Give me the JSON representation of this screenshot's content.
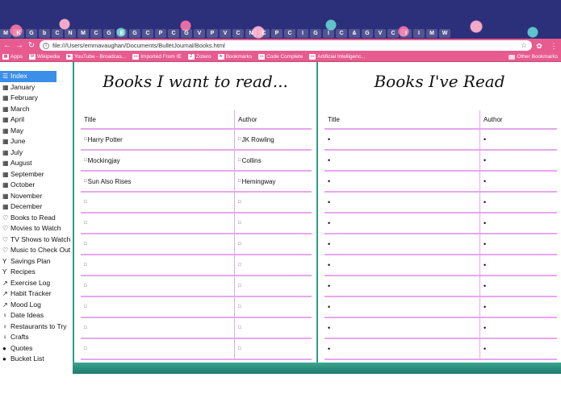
{
  "browser": {
    "tab_favicons": [
      "M",
      "K",
      "G",
      "b",
      "C",
      "N",
      "M",
      "C",
      "G",
      "E",
      "G",
      "C",
      "P",
      "C",
      "G",
      "V",
      "P",
      "V",
      "C",
      "N",
      "C",
      "P",
      "C",
      "I",
      "G",
      "I",
      "C",
      "&",
      "G",
      "V",
      "C",
      "I",
      "I",
      "M",
      "W"
    ],
    "url": "file:///Users/emmavaughan/Documents/BulletJournal/Books.html",
    "bookmarks": [
      {
        "icon": "apps-icon",
        "label": "Apps"
      },
      {
        "icon": "W",
        "label": "Wikipedia"
      },
      {
        "icon": "▶",
        "label": "YouTube - Broadcas..."
      },
      {
        "icon": "▭",
        "label": "Imported From IE"
      },
      {
        "icon": "Z",
        "label": "Zotero"
      },
      {
        "icon": "★",
        "label": "Bookmarks"
      },
      {
        "icon": "▭",
        "label": "Code Complete"
      },
      {
        "icon": "▭",
        "label": "Artificial Intelligenc..."
      }
    ],
    "other_bookmarks": "Other Bookmarks"
  },
  "sidebar": {
    "items": [
      {
        "icon": "☰",
        "label": "Index",
        "active": true
      },
      {
        "icon": "▦",
        "label": "January"
      },
      {
        "icon": "▦",
        "label": "February"
      },
      {
        "icon": "▦",
        "label": "March"
      },
      {
        "icon": "▦",
        "label": "April"
      },
      {
        "icon": "▦",
        "label": "May"
      },
      {
        "icon": "▦",
        "label": "June"
      },
      {
        "icon": "▦",
        "label": "July"
      },
      {
        "icon": "▦",
        "label": "August"
      },
      {
        "icon": "▦",
        "label": "September"
      },
      {
        "icon": "▦",
        "label": "October"
      },
      {
        "icon": "▦",
        "label": "November"
      },
      {
        "icon": "▦",
        "label": "December"
      },
      {
        "icon": "♡",
        "label": "Books to Read"
      },
      {
        "icon": "♡",
        "label": "Movies to Watch"
      },
      {
        "icon": "♡",
        "label": "TV Shows to Watch"
      },
      {
        "icon": "♡",
        "label": "Music to Check Out"
      },
      {
        "icon": "Y",
        "label": "Savings Plan"
      },
      {
        "icon": "Y",
        "label": "Recipes"
      },
      {
        "icon": "↗",
        "label": "Exercise Log"
      },
      {
        "icon": "↗",
        "label": "Habit Tracker"
      },
      {
        "icon": "↗",
        "label": "Mood Log"
      },
      {
        "icon": "♀",
        "label": "Date Ideas"
      },
      {
        "icon": "♀",
        "label": "Restaurants to Try"
      },
      {
        "icon": "♀",
        "label": "Crafts"
      },
      {
        "icon": "●",
        "label": "Quotes"
      },
      {
        "icon": "●",
        "label": "Bucket List"
      }
    ]
  },
  "want_to_read": {
    "title": "Books I want to read...",
    "col_title": "Title",
    "col_author": "Author",
    "rows": [
      {
        "title": "Harry Potter",
        "author": "JK Rowling"
      },
      {
        "title": "Mockingjay",
        "author": "Collins"
      },
      {
        "title": "Sun Also Rises",
        "author": "Hemingway"
      },
      {
        "title": "",
        "author": ""
      },
      {
        "title": "",
        "author": ""
      },
      {
        "title": "",
        "author": ""
      },
      {
        "title": "",
        "author": ""
      },
      {
        "title": "",
        "author": ""
      },
      {
        "title": "",
        "author": ""
      },
      {
        "title": "",
        "author": ""
      },
      {
        "title": "",
        "author": ""
      }
    ]
  },
  "read": {
    "title": "Books I've Read",
    "col_title": "Title",
    "col_author": "Author",
    "rows": [
      {
        "title": "",
        "author": ""
      },
      {
        "title": "",
        "author": ""
      },
      {
        "title": "",
        "author": ""
      },
      {
        "title": "",
        "author": ""
      },
      {
        "title": "",
        "author": ""
      },
      {
        "title": "",
        "author": ""
      },
      {
        "title": "",
        "author": ""
      },
      {
        "title": "",
        "author": ""
      },
      {
        "title": "",
        "author": ""
      },
      {
        "title": "",
        "author": ""
      },
      {
        "title": "",
        "author": ""
      }
    ]
  },
  "colors": {
    "accent_teal": "#2e9b8f",
    "row_line": "#e6a7ef",
    "toolbar_pink": "#e85b8e",
    "active_blue": "#3b8fe8"
  }
}
